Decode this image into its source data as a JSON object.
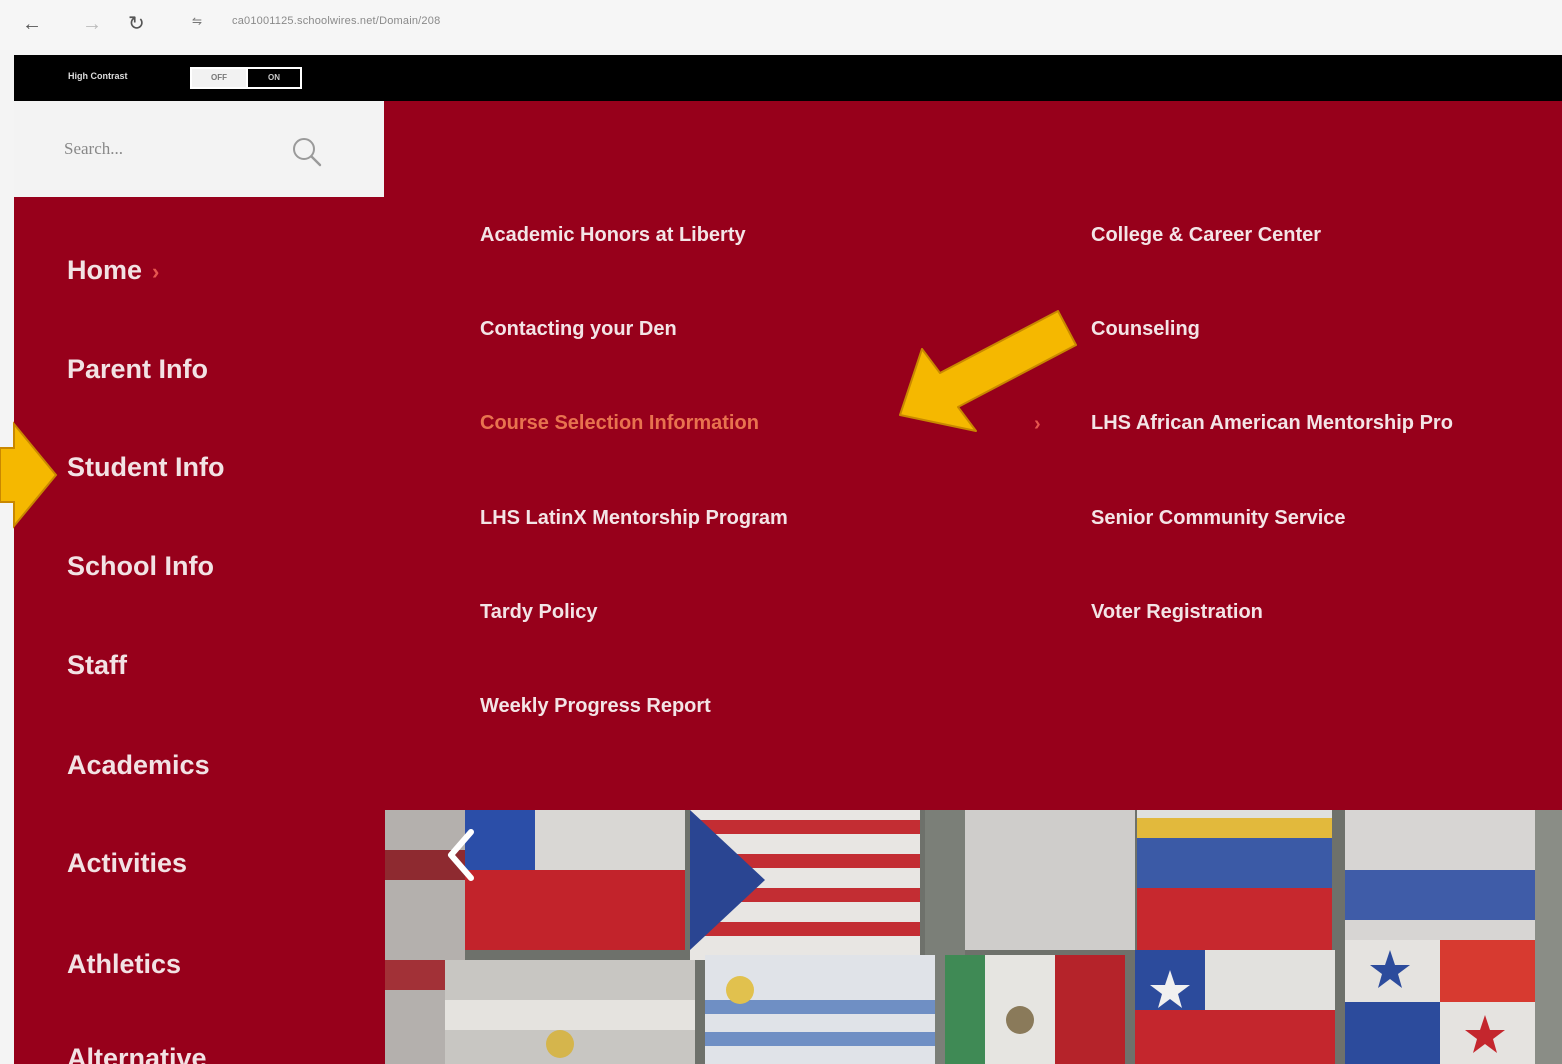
{
  "browser": {
    "url": "ca01001125.schoolwires.net/Domain/208"
  },
  "accessibility": {
    "high_contrast_label": "High Contrast",
    "off_label": "OFF",
    "on_label": "ON"
  },
  "search": {
    "placeholder": "Search..."
  },
  "sidebar": {
    "items": [
      {
        "label": "Home"
      },
      {
        "label": "Parent Info"
      },
      {
        "label": "Student Info"
      },
      {
        "label": "School Info"
      },
      {
        "label": "Staff"
      },
      {
        "label": "Academics"
      },
      {
        "label": "Activities"
      },
      {
        "label": "Athletics"
      },
      {
        "label": "Alternative"
      }
    ]
  },
  "menu": {
    "col1": [
      {
        "label": "Academic Honors at Liberty"
      },
      {
        "label": "Contacting your Den"
      },
      {
        "label": "Course Selection Information",
        "active": true
      },
      {
        "label": "LHS LatinX Mentorship Program"
      },
      {
        "label": "Tardy Policy"
      },
      {
        "label": "Weekly Progress Report"
      }
    ],
    "col2": [
      {
        "label": "College & Career Center"
      },
      {
        "label": "Counseling"
      },
      {
        "label": "LHS African American Mentorship Pro"
      },
      {
        "label": "Senior Community Service"
      },
      {
        "label": "Voter Registration"
      }
    ]
  },
  "colors": {
    "brand_red": "#97001b",
    "active_link": "#e8734f",
    "annotation_arrow": "#f5b800"
  },
  "icons": {
    "back": "arrow-left-icon",
    "forward": "arrow-right-icon",
    "reload": "reload-icon",
    "site_info": "tune-icon",
    "search": "search-icon",
    "carousel_prev": "chevron-left-icon",
    "sidebar_home_chevron": "chevron-right-icon",
    "submenu_chevron": "chevron-right-icon"
  }
}
